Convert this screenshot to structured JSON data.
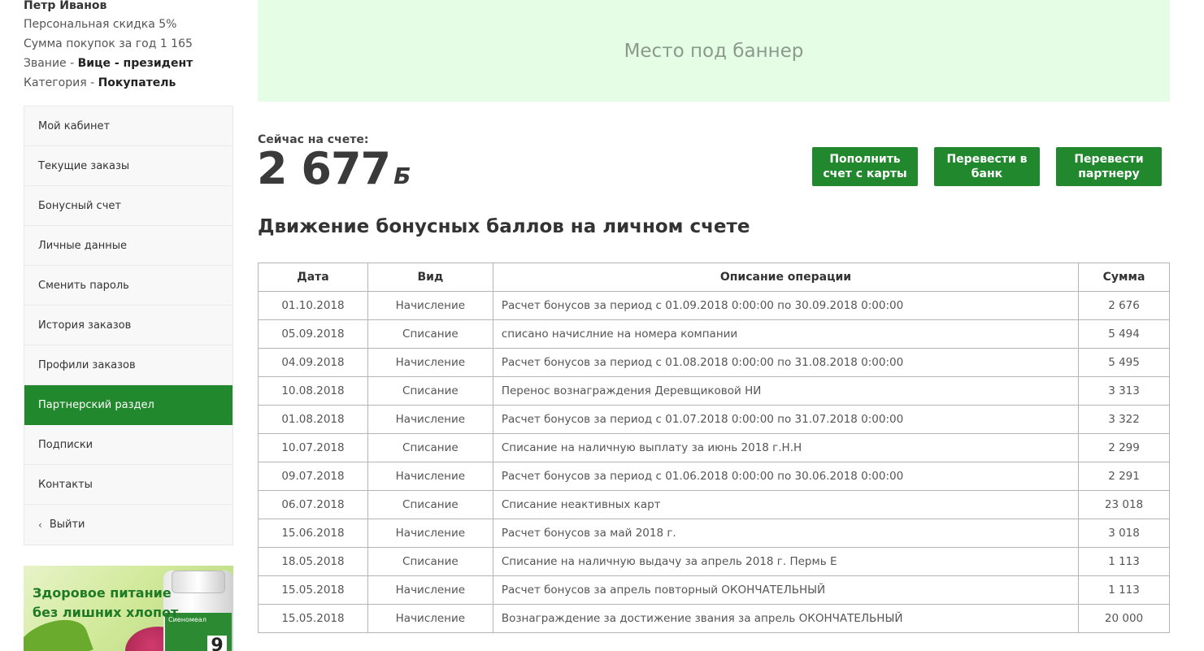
{
  "user": {
    "name": "Петр Иванов",
    "discount": "Персональная скидка 5%",
    "purchases": "Сумма покупок за год 1 165",
    "rank_label": "Звание - ",
    "rank_value": "Вице - президент",
    "category_label": "Категория - ",
    "category_value": "Покупатель"
  },
  "menu": {
    "items": [
      {
        "label": "Мой кабинет"
      },
      {
        "label": "Текущие заказы"
      },
      {
        "label": "Бонусный счет"
      },
      {
        "label": "Личные данные"
      },
      {
        "label": "Сменить пароль"
      },
      {
        "label": "История заказов"
      },
      {
        "label": "Профили заказов"
      },
      {
        "label": "Партнерский раздел",
        "active": true
      },
      {
        "label": "Подписки"
      },
      {
        "label": "Контакты"
      },
      {
        "label": "Выйти",
        "icon": "chevron-left-icon"
      }
    ]
  },
  "promo": {
    "text_line1": "Здоровое питание",
    "text_line2": "без лишних хлопот",
    "brand": "Сиеномеал",
    "jar_number": "9"
  },
  "banner": {
    "text": "Место под баннер"
  },
  "balance": {
    "label": "Сейчас на счете:",
    "amount": "2 677",
    "currency": "Б"
  },
  "actions": {
    "topup": "Пополнить\nсчет с карты",
    "to_bank": "Перевести в\nбанк",
    "to_partner": "Перевести\nпартнеру"
  },
  "section_title": "Движение бонусных баллов на личном счете",
  "table": {
    "headers": [
      "Дата",
      "Вид",
      "Описание операции",
      "Сумма"
    ],
    "rows": [
      [
        "01.10.2018",
        "Начисление",
        "Расчет бонусов за период с 01.09.2018 0:00:00 по 30.09.2018 0:00:00",
        "2 676"
      ],
      [
        "05.09.2018",
        "Списание",
        "списано начислние на номера компании",
        "5 494"
      ],
      [
        "04.09.2018",
        "Начисление",
        "Расчет бонусов за период с 01.08.2018 0:00:00 по 31.08.2018 0:00:00",
        "5 495"
      ],
      [
        "10.08.2018",
        "Списание",
        "Перенос вознаграждения Деревщиковой НИ",
        "3 313"
      ],
      [
        "01.08.2018",
        "Начисление",
        "Расчет бонусов за период с 01.07.2018 0:00:00 по 31.07.2018 0:00:00",
        "3 322"
      ],
      [
        "10.07.2018",
        "Списание",
        "Списание на наличную выплату за июнь 2018 г.Н.Н",
        "2 299"
      ],
      [
        "09.07.2018",
        "Начисление",
        "Расчет бонусов за период с 01.06.2018 0:00:00 по 30.06.2018 0:00:00",
        "2 291"
      ],
      [
        "06.07.2018",
        "Списание",
        "Списание неактивных карт",
        "23 018"
      ],
      [
        "15.06.2018",
        "Начисление",
        "Расчет бонусов за май 2018 г.",
        "3 018"
      ],
      [
        "18.05.2018",
        "Списание",
        "Списание на наличную выдачу за апрель 2018 г. Пермь Е",
        "1 113"
      ],
      [
        "15.05.2018",
        "Начисление",
        "Расчет бонусов за апрель повторный ОКОНЧАТЕЛЬНЫЙ",
        "1 113"
      ],
      [
        "15.05.2018",
        "Начисление",
        "Вознаграждение за достижение звания за апрель ОКОНЧАТЕЛЬНЫЙ",
        "20 000"
      ]
    ]
  },
  "colors": {
    "accent": "#22882d",
    "banner_bg": "#e5fde5"
  }
}
